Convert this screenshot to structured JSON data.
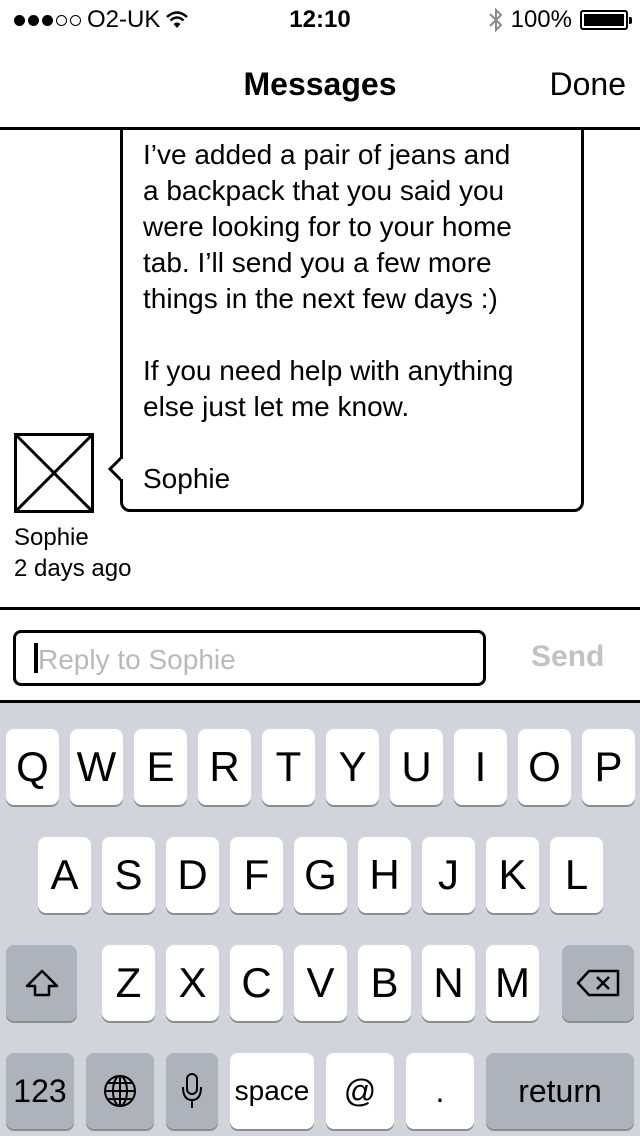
{
  "status_bar": {
    "carrier": "O2-UK",
    "time": "12:10",
    "battery": "100%"
  },
  "nav": {
    "title": "Messages",
    "done_label": "Done"
  },
  "message": {
    "text": "I’ve added a pair of jeans and\na backpack that you said you\nwere looking for to your home\ntab. I’ll send you a few more\nthings in the next few days :)\n\nIf you need help with anything\nelse just let me know.\n\nSophie",
    "sender": "Sophie",
    "time_ago": "2 days ago"
  },
  "reply": {
    "placeholder": "Reply to Sophie",
    "send_label": "Send"
  },
  "keyboard": {
    "row1": [
      "Q",
      "W",
      "E",
      "R",
      "T",
      "Y",
      "U",
      "I",
      "O",
      "P"
    ],
    "row2": [
      "A",
      "S",
      "D",
      "F",
      "G",
      "H",
      "J",
      "K",
      "L"
    ],
    "row3": [
      "Z",
      "X",
      "C",
      "V",
      "B",
      "N",
      "M"
    ],
    "numbers_label": "123",
    "space_label": "space",
    "at_label": "@",
    "period_label": ".",
    "return_label": "return"
  }
}
